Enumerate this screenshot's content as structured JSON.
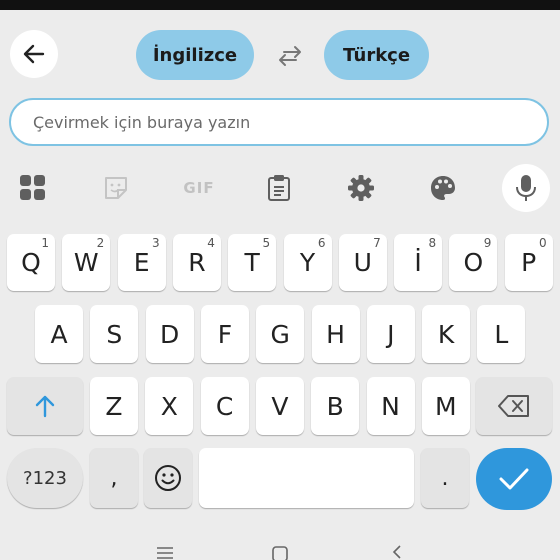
{
  "header": {
    "back_icon": "arrow-left-icon",
    "source_language": "İngilizce",
    "target_language": "Türkçe",
    "swap_icon": "swap-arrows-icon"
  },
  "input": {
    "placeholder": "Çevirmek için buraya yazın"
  },
  "toolbar": {
    "icons": [
      "grid-apps-icon",
      "sticker-icon",
      "gif-icon",
      "clipboard-icon",
      "gear-icon",
      "palette-icon",
      "mic-icon"
    ],
    "gif_label": "GIF"
  },
  "keyboard": {
    "row1": [
      {
        "label": "Q",
        "hint": "1"
      },
      {
        "label": "W",
        "hint": "2"
      },
      {
        "label": "E",
        "hint": "3"
      },
      {
        "label": "R",
        "hint": "4"
      },
      {
        "label": "T",
        "hint": "5"
      },
      {
        "label": "Y",
        "hint": "6"
      },
      {
        "label": "U",
        "hint": "7"
      },
      {
        "label": "İ",
        "hint": "8"
      },
      {
        "label": "O",
        "hint": "9"
      },
      {
        "label": "P",
        "hint": "0"
      }
    ],
    "row2": [
      "A",
      "S",
      "D",
      "F",
      "G",
      "H",
      "J",
      "K",
      "L"
    ],
    "row3": [
      "Z",
      "X",
      "C",
      "V",
      "B",
      "N",
      "M"
    ],
    "bottom": {
      "symbols_label": "?123",
      "comma_label": ",",
      "period_label": "."
    }
  },
  "accent_color": "#2f97dc",
  "pill_color": "#8ecae8"
}
